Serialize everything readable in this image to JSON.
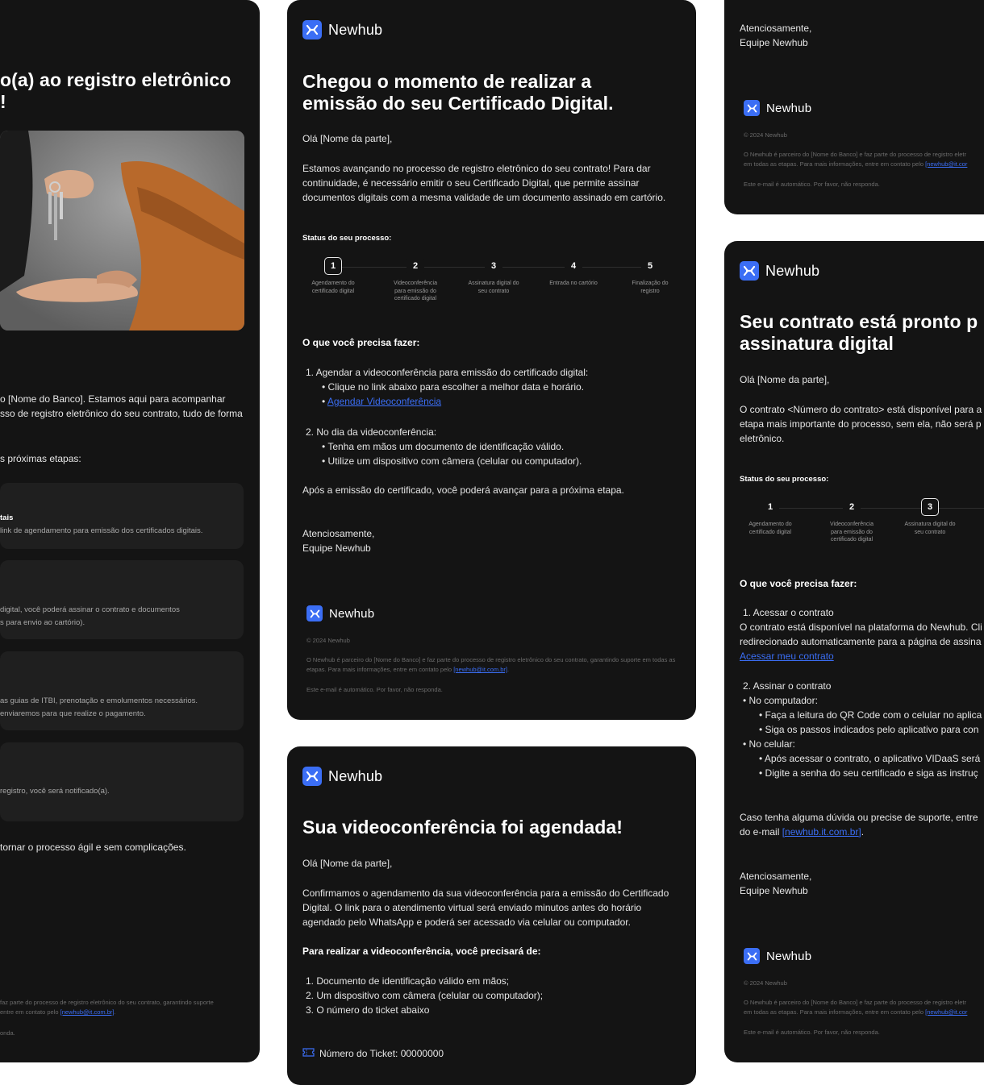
{
  "colors": {
    "background": "#ffffff",
    "card": "#141414",
    "accent": "#3b6ef5",
    "muted": "#6b6b6b"
  },
  "brand": {
    "name": "Newhub",
    "icon": "newhub-logo-icon"
  },
  "footer": {
    "copyright": "© 2024 Newhub",
    "disclaimer_pre": "O Newhub é parceiro do [Nome do Banco] e faz parte do processo de registro eletrônico do seu contrato, garantindo suporte em todas as etapas. Para mais informações, entre em contato pelo ",
    "disclaimer_link": "[newhub@it.com.br]",
    "disclaimer_post": ".",
    "auto": "Este e-mail é automático. Por favor, não responda."
  },
  "card_left": {
    "title_line1": "o(a) ao registro eletrônico",
    "title_line2": "!",
    "image_alt": "hands-with-keys-photo",
    "intro_line1": "o [Nome do Banco]. Estamos aqui para acompanhar",
    "intro_line2": "sso de registro eletrônico do seu contrato, tudo de forma",
    "next_steps": "s próximas etapas:",
    "box1_title": "tais",
    "box1_text": "link de agendamento para emissão dos certificados digitais.",
    "box2_text1": "digital, você poderá assinar o contrato e documentos",
    "box2_text2": "s para envio ao cartório).",
    "box3_text1": "as guias de ITBI, prenotação e emolumentos necessários.",
    "box3_text2": "enviaremos para que realize o pagamento.",
    "box4_text": "registro, você será notificado(a).",
    "closing": "tornar o processo ágil e sem complicações.",
    "footer_l1": "faz parte do processo de registro eletrônico do seu contrato, garantindo suporte",
    "footer_l2_pre": "entre em contato pelo ",
    "footer_l2_link": "[newhub@it.com.br]",
    "footer_l2_post": ".",
    "footer_l3": "onda."
  },
  "card_center_top": {
    "title_line1": "Chegou o momento de realizar a",
    "title_line2": "emissão do seu Certificado Digital.",
    "greeting": "Olá [Nome da parte],",
    "intro": "Estamos avançando no processo de registro eletrônico do seu contrato! Para dar continuidade, é necessário emitir o seu Certificado Digital, que permite assinar documentos digitais com a mesma validade de um documento assinado em cartório.",
    "status_title": "Status do seu processo:",
    "steps": [
      {
        "num": "1",
        "label": "Agendamento do certificado digital"
      },
      {
        "num": "2",
        "label": "Videoconferência para emissão do certificado digital"
      },
      {
        "num": "3",
        "label": "Assinatura digital do seu contrato"
      },
      {
        "num": "4",
        "label": "Entrada no cartório"
      },
      {
        "num": "5",
        "label": "Finalização do registro"
      }
    ],
    "todo_title": "O que você precisa fazer:",
    "item1": "1. Agendar a videoconferência para emissão do certificado digital:",
    "item1_a": "•  Clique no link abaixo para escolher a melhor data e horário.",
    "item1_b_bullet": "•  ",
    "item1_b_link": "Agendar Videoconferência",
    "item2": "2. No dia da videoconferência:",
    "item2_a": "•  Tenha em mãos um documento de identificação válido.",
    "item2_b": "•  Utilize um dispositivo com câmera (celular ou computador).",
    "after": "Após a emissão do certificado, você poderá avançar para a próxima etapa.",
    "regards": "Atenciosamente,",
    "team": "Equipe Newhub"
  },
  "card_center_bottom": {
    "title": "Sua videoconferência foi agendada!",
    "greeting": "Olá [Nome da parte],",
    "intro": "Confirmamos o agendamento da sua videoconferência para a emissão do Certificado Digital. O link para o atendimento virtual será enviado minutos antes do horário agendado pelo WhatsApp e poderá ser acessado via celular ou computador.",
    "req_title": "Para realizar a videoconferência, você precisará de:",
    "req1": "1. Documento de identificação válido em mãos;",
    "req2": "2. Um dispositivo com câmera (celular ou computador);",
    "req3": "3. O número do ticket abaixo",
    "ticket": "Número do Ticket: 00000000"
  },
  "card_right_top": {
    "regards": "Atenciosamente,",
    "team": "Equipe Newhub",
    "footer_l1": "O Newhub é parceiro do [Nome do Banco] e faz parte do processo de registro eletr",
    "footer_l2_pre": "em todas as etapas. Para mais informações, entre em contato pelo ",
    "footer_l2_link": "[newhub@it.cor"
  },
  "card_right_bottom": {
    "title_line1": "Seu contrato está pronto p",
    "title_line2": "assinatura digital",
    "greeting": "Olá [Nome da parte],",
    "intro_l1": "O contrato <Número do contrato> está disponível para a",
    "intro_l2": "etapa mais importante do processo, sem ela, não será p",
    "intro_l3": "eletrônico.",
    "status_title": "Status do seu processo:",
    "steps": [
      {
        "num": "1",
        "label": "Agendamento do certificado digital"
      },
      {
        "num": "2",
        "label": "Videoconferência para emissão do certificado digital"
      },
      {
        "num": "3",
        "label": "Assinatura digital do seu contrato"
      }
    ],
    "todo_title": "O que você precisa fazer:",
    "item1": "1. Acessar o contrato",
    "item1_text_l1": "O contrato está disponível na plataforma do Newhub. Cli",
    "item1_text_l2": "redirecionado automaticamente para a página de assina",
    "item1_link": "Acessar meu contrato",
    "item2": "2.  Assinar o contrato",
    "pc": "•  No computador:",
    "pc_a": "•  Faça a leitura do QR Code com o celular no aplica",
    "pc_b": "•  Siga os passos indicados pelo aplicativo para con",
    "mobile": "•  No celular:",
    "mobile_a": "•  Após acessar o contrato, o aplicativo VIDaaS será",
    "mobile_b": "•  Digite a senha do seu certificado e siga as instruç",
    "support_l1": "Caso tenha alguma dúvida ou precise de suporte, entre",
    "support_l2_pre": "do e-mail ",
    "support_l2_link": "[newhub.it.com.br]",
    "support_l2_post": ".",
    "regards": "Atenciosamente,",
    "team": "Equipe Newhub",
    "footer_l1": "O Newhub é parceiro do [Nome do Banco] e faz parte do processo de registro eletr",
    "footer_l2_pre": "em todas as etapas. Para mais informações, entre em contato pelo ",
    "footer_l2_link": "[newhub@it.cor"
  }
}
